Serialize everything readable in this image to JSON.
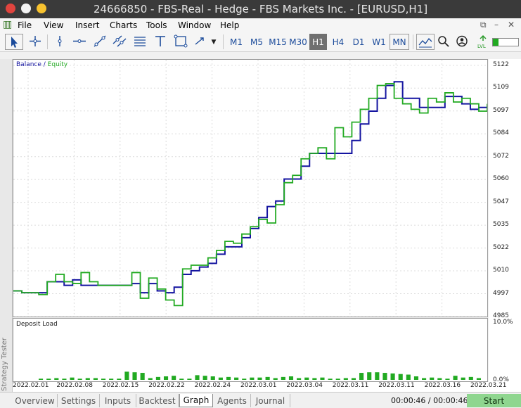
{
  "window": {
    "title": "24666850 - FBS-Real - Hedge - FBS Markets Inc. - [EURUSD,H1]"
  },
  "menu": [
    "File",
    "View",
    "Insert",
    "Charts",
    "Tools",
    "Window",
    "Help"
  ],
  "window_controls": {
    "restore": "⧉",
    "minimize": "–",
    "close": "✕"
  },
  "timeframes": [
    "M1",
    "M5",
    "M15",
    "M30",
    "H1",
    "H4",
    "D1",
    "W1",
    "MN"
  ],
  "selected_timeframe": "H1",
  "legend": {
    "balance": "Balance",
    "sep": " / ",
    "equity": "Equity",
    "balance_color": "#1414a0",
    "equity_color": "#22aa22"
  },
  "deposit_load": {
    "label": "Deposit Load",
    "max": "10.0%",
    "min": "0.0%"
  },
  "chart_data": {
    "type": "line",
    "x_labels": [
      "2022.02.01",
      "2022.02.08",
      "2022.02.15",
      "2022.02.22",
      "2022.02.24",
      "2022.03.01",
      "2022.03.04",
      "2022.03.11",
      "2022.03.11",
      "2022.03.16",
      "2022.03.21"
    ],
    "y_labels": [
      "5122",
      "5109",
      "5097",
      "5084",
      "5072",
      "5060",
      "5047",
      "5035",
      "5022",
      "5010",
      "4997",
      "4985"
    ],
    "ylim": [
      4985,
      5125
    ],
    "series": [
      {
        "name": "Balance",
        "color": "#1414a0",
        "values": [
          4999,
          4998,
          4998,
          4998,
          5004,
          5004,
          5002,
          5005,
          5002,
          5002,
          5002,
          5002,
          5002,
          5002,
          5003,
          4998,
          5003,
          4999,
          4998,
          5001,
          5008,
          5010,
          5012,
          5014,
          5019,
          5023,
          5023,
          5028,
          5033,
          5039,
          5045,
          5048,
          5060,
          5060,
          5067,
          5074,
          5074,
          5074,
          5074,
          5074,
          5081,
          5090,
          5097,
          5104,
          5111,
          5113,
          5104,
          5104,
          5099,
          5099,
          5099,
          5105,
          5105,
          5101,
          5098,
          5099,
          5100
        ]
      },
      {
        "name": "Equity",
        "color": "#22aa22",
        "values": [
          4999,
          4998,
          4998,
          4997,
          5004,
          5008,
          5004,
          5003,
          5009,
          5004,
          5002,
          5002,
          5002,
          5002,
          5009,
          4995,
          5006,
          5000,
          4994,
          4991,
          5011,
          5013,
          5013,
          5017,
          5021,
          5026,
          5025,
          5030,
          5034,
          5038,
          5036,
          5046,
          5058,
          5062,
          5071,
          5074,
          5077,
          5071,
          5088,
          5083,
          5091,
          5098,
          5104,
          5111,
          5112,
          5104,
          5101,
          5098,
          5096,
          5104,
          5102,
          5107,
          5102,
          5104,
          5101,
          5097,
          5101
        ]
      }
    ],
    "deposit_load_values": [
      0.2,
      0.2,
      0.3,
      0.2,
      0.4,
      0.2,
      0.3,
      0.3,
      0.2,
      0.2,
      0.2,
      1.4,
      1.3,
      1.2,
      0.3,
      0.5,
      0.6,
      0.7,
      0.2,
      0.2,
      0.8,
      0.7,
      0.6,
      0.4,
      0.5,
      0.4,
      0.2,
      0.4,
      0.4,
      0.5,
      0.3,
      0.5,
      0.6,
      0.3,
      0.4,
      0.3,
      0.4,
      0.2,
      0.2,
      0.3,
      0.3,
      1.2,
      1.3,
      1.3,
      1.2,
      1.1,
      1.0,
      0.9,
      0.6,
      0.3,
      0.4,
      0.3,
      0.2,
      0.7,
      0.4,
      0.5,
      0.3
    ],
    "deposit_load_ylim": [
      0,
      10
    ]
  },
  "tabs": [
    "Overview",
    "Settings",
    "Inputs",
    "Backtest",
    "Graph",
    "Agents",
    "Journal"
  ],
  "active_tab": "Graph",
  "side_tab_label": "Strategy Tester",
  "timer": "00:00:46 / 00:00:46",
  "start_label": "Start"
}
